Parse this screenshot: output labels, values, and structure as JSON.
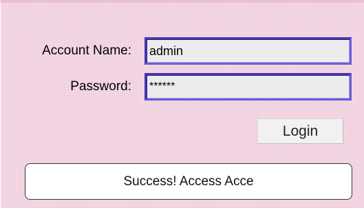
{
  "form": {
    "account_label": "Account Name:",
    "account_value": "admin",
    "password_label": "Password:",
    "password_value": "******",
    "login_label": "Login"
  },
  "status": {
    "message": "Success! Access Acce"
  },
  "colors": {
    "background": "#f6d9e6",
    "field_border": "#6b5ed8",
    "field_fill": "#ececec",
    "status_fill": "#ffffff"
  }
}
